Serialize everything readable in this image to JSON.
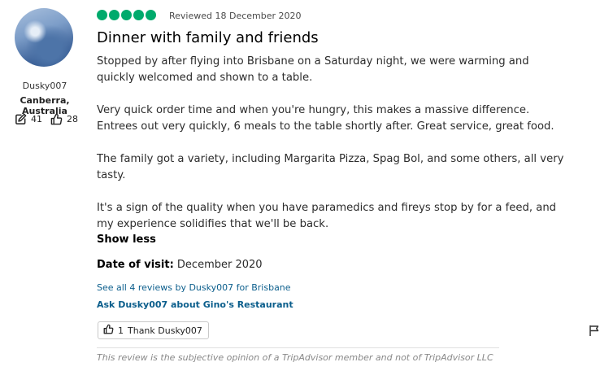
{
  "reviewer": {
    "username": "Dusky007",
    "location": "Canberra, Australia",
    "contributions": "41",
    "helpful_votes": "28"
  },
  "review": {
    "rating": 5,
    "reviewed_date": "Reviewed 18 December 2020",
    "title": "Dinner with family and friends",
    "paragraphs": [
      "Stopped by after flying into Brisbane on a Saturday night, we were warming and quickly welcomed and shown to a table.",
      "Very quick order time and when you're hungry, this makes a massive difference. Entrees out very quickly, 6 meals to the table shortly after. Great service, great food.",
      "The family got a variety, including Margarita Pizza, Spag Bol, and some others, all very tasty.",
      "It's a sign of the quality when you have paramedics and fireys stop by for a feed, and my experience solidifies that we'll be back."
    ],
    "show_less_label": "Show less",
    "date_of_visit_label": "Date of visit:",
    "date_of_visit_value": "December 2020",
    "see_all_link": "See all 4 reviews by Dusky007 for Brisbane",
    "ask_link": "Ask Dusky007 about Gino's Restaurant",
    "thank_count": "1",
    "thank_label": "Thank Dusky007",
    "disclaimer": "This review is the subjective opinion of a TripAdvisor member and not of TripAdvisor LLC"
  },
  "colors": {
    "rating_bubble": "#00aa6c",
    "link": "#0b5e8c"
  },
  "icons": {
    "contributions": "pencil-edit-icon",
    "helpful": "thumbs-up-icon",
    "report": "flag-icon"
  }
}
